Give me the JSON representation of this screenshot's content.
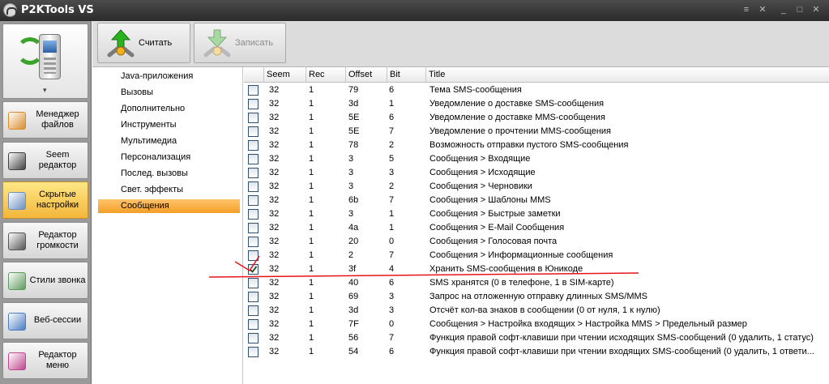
{
  "app": {
    "title": "P2KTools VS"
  },
  "window_controls": {
    "menu": "≡",
    "close": "✕",
    "minimize": "_",
    "maximize": "□"
  },
  "sidebar": {
    "dropdown_icon": "chevron-down-icon",
    "items": [
      {
        "label": "Менеджер файлов",
        "icon": "file-manager-icon",
        "color": "#d98d2b"
      },
      {
        "label": "Seem редактор",
        "icon": "seem-editor-icon",
        "color": "#404040"
      },
      {
        "label": "Скрытые настройки",
        "icon": "hidden-settings-icon",
        "color": "#6e8fbf",
        "active": true
      },
      {
        "label": "Редактор громкости",
        "icon": "volume-editor-icon",
        "color": "#555555"
      },
      {
        "label": "Стили звонка",
        "icon": "ring-styles-icon",
        "color": "#5e9a5e"
      },
      {
        "label": "Веб-сессии",
        "icon": "web-sessions-icon",
        "color": "#4b7cc2"
      },
      {
        "label": "Редактор меню",
        "icon": "menu-editor-icon",
        "color": "#c0468d"
      }
    ]
  },
  "toolbar": {
    "read_label": "Считать",
    "write_label": "Записать",
    "read_icon": "read-arrow-icon",
    "write_icon": "write-arrow-icon",
    "accent": "#2bb31f"
  },
  "tree": {
    "items": [
      "Java-приложения",
      "Вызовы",
      "Дополнительно",
      "Инструменты",
      "Мультимедиа",
      "Персонализация",
      "Послед. вызовы",
      "Свет. эффекты",
      "Сообщения"
    ],
    "selected_index": 8
  },
  "table": {
    "columns": [
      "Seem",
      "Rec",
      "Offset",
      "Bit",
      "Title"
    ],
    "rows": [
      {
        "checked": false,
        "seem": "32",
        "rec": "1",
        "offset": "79",
        "bit": "6",
        "title": "Тема SMS-сообщения"
      },
      {
        "checked": false,
        "seem": "32",
        "rec": "1",
        "offset": "3d",
        "bit": "1",
        "title": "Уведомление о доставке SMS-сообщения"
      },
      {
        "checked": false,
        "seem": "32",
        "rec": "1",
        "offset": "5E",
        "bit": "6",
        "title": "Уведомление о доставке MMS-сообщения"
      },
      {
        "checked": false,
        "seem": "32",
        "rec": "1",
        "offset": "5E",
        "bit": "7",
        "title": "Уведомление о прочтении MMS-сообщения"
      },
      {
        "checked": false,
        "seem": "32",
        "rec": "1",
        "offset": "78",
        "bit": "2",
        "title": "Возможность отправки пустого SMS-сообщения"
      },
      {
        "checked": false,
        "seem": "32",
        "rec": "1",
        "offset": "3",
        "bit": "5",
        "title": "Сообщения > Входящие"
      },
      {
        "checked": false,
        "seem": "32",
        "rec": "1",
        "offset": "3",
        "bit": "3",
        "title": "Сообщения > Исходящие"
      },
      {
        "checked": false,
        "seem": "32",
        "rec": "1",
        "offset": "3",
        "bit": "2",
        "title": "Сообщения > Черновики"
      },
      {
        "checked": false,
        "seem": "32",
        "rec": "1",
        "offset": "6b",
        "bit": "7",
        "title": "Сообщения > Шаблоны MMS"
      },
      {
        "checked": false,
        "seem": "32",
        "rec": "1",
        "offset": "3",
        "bit": "1",
        "title": "Сообщения > Быстрые заметки"
      },
      {
        "checked": false,
        "seem": "32",
        "rec": "1",
        "offset": "4a",
        "bit": "1",
        "title": "Сообщения > E-Mail Сообщения"
      },
      {
        "checked": false,
        "seem": "32",
        "rec": "1",
        "offset": "20",
        "bit": "0",
        "title": "Сообщения > Голосовая почта"
      },
      {
        "checked": false,
        "seem": "32",
        "rec": "1",
        "offset": "2",
        "bit": "7",
        "title": "Сообщения > Информационные сообщения"
      },
      {
        "checked": true,
        "seem": "32",
        "rec": "1",
        "offset": "3f",
        "bit": "4",
        "title": "Хранить SMS-сообщения в Юникоде"
      },
      {
        "checked": false,
        "seem": "32",
        "rec": "1",
        "offset": "40",
        "bit": "6",
        "title": "SMS хранятся (0 в телефоне, 1 в SIM-карте)"
      },
      {
        "checked": false,
        "seem": "32",
        "rec": "1",
        "offset": "69",
        "bit": "3",
        "title": "Запрос на отложенную отправку длинных SMS/MMS"
      },
      {
        "checked": false,
        "seem": "32",
        "rec": "1",
        "offset": "3d",
        "bit": "3",
        "title": "Отсчёт кол-ва знаков в сообщении (0 от нуля, 1 к нулю)"
      },
      {
        "checked": false,
        "seem": "32",
        "rec": "1",
        "offset": "7F",
        "bit": "0",
        "title": "Сообщения > Настройка входящих > Настройка MMS > Предельный размер"
      },
      {
        "checked": false,
        "seem": "32",
        "rec": "1",
        "offset": "56",
        "bit": "7",
        "title": "Функция правой софт-клавиши при чтении исходящих SMS-сообщений (0 удалить, 1 статус)"
      },
      {
        "checked": false,
        "seem": "32",
        "rec": "1",
        "offset": "54",
        "bit": "6",
        "title": "Функция правой софт-клавиши при чтении входящих SMS-сообщений (0 удалить, 1 ответи..."
      }
    ]
  },
  "annotation": {
    "color": "#e8141a",
    "marks": "checkmark-and-underline"
  }
}
